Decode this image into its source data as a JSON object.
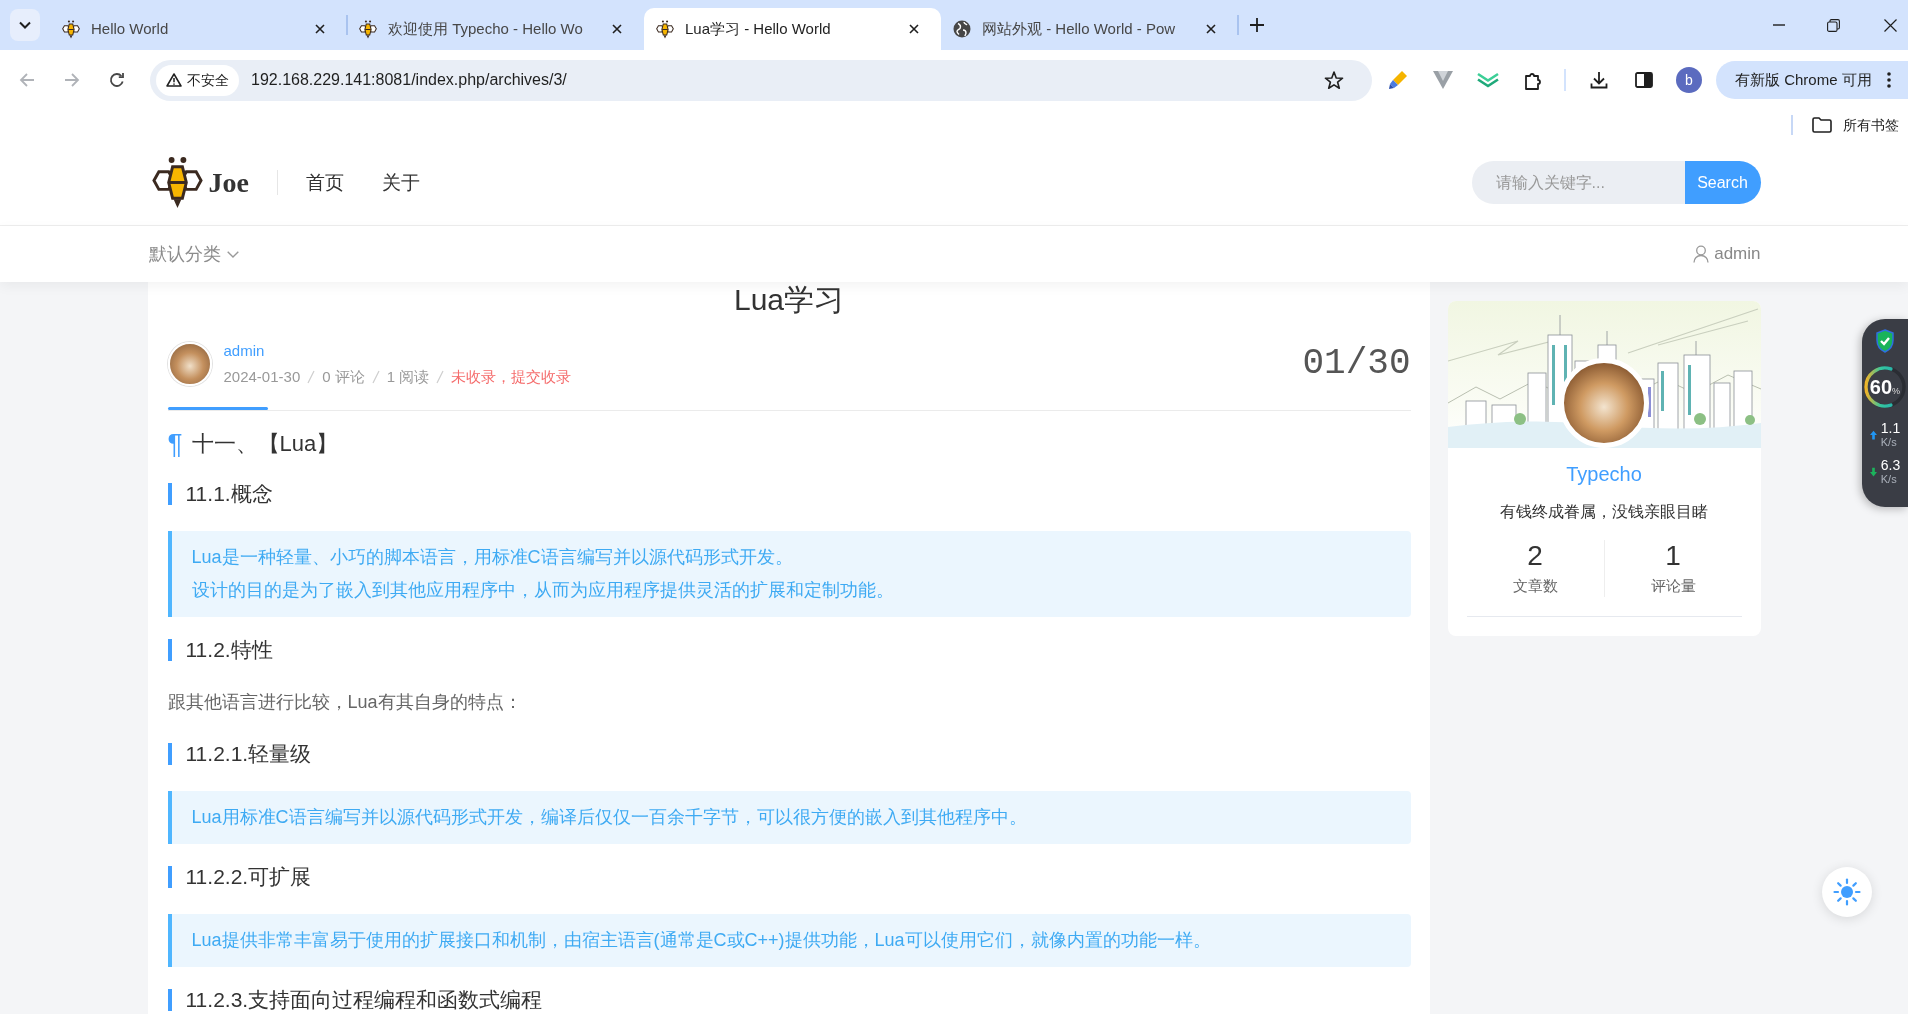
{
  "browser": {
    "tab_strip": {
      "tabs": [
        {
          "title": "Hello World",
          "kind": "bee",
          "selected": false
        },
        {
          "title": "欢迎使用 Typecho - Hello Wo",
          "kind": "bee",
          "selected": false
        },
        {
          "title": "Lua学习 - Hello World",
          "kind": "bee",
          "selected": true
        },
        {
          "title": "网站外观 - Hello World - Pow",
          "kind": "globe",
          "selected": false
        }
      ]
    },
    "toolbar": {
      "back": {
        "disabled": true
      },
      "forward": {
        "disabled": true
      },
      "security_chip": "不安全",
      "url": "192.168.229.141:8081/index.php/archives/3/",
      "profile_initial": "b",
      "update_button": "有新版 Chrome 可用"
    },
    "bookmarks_bar": {
      "folder": "所有书签"
    }
  },
  "site_header": {
    "logo_text": "Joe",
    "nav": [
      {
        "label": "首页"
      },
      {
        "label": "关于"
      }
    ],
    "search": {
      "placeholder": "请输入关键字...",
      "button": "Search"
    }
  },
  "sub_nav": {
    "category": "默认分类",
    "user": "admin"
  },
  "article": {
    "title": "Lua学习",
    "author": "admin",
    "meta": [
      {
        "kind": "plain",
        "text": "2024-01-30"
      },
      {
        "kind": "plain",
        "text": "0 评论"
      },
      {
        "kind": "plain",
        "text": "1 阅读"
      },
      {
        "kind": "alert",
        "text": "未收录，提交收录"
      }
    ],
    "date_badge": "01/30",
    "content": [
      {
        "kind": "h1",
        "anchor": "¶",
        "text": "十一、【Lua】"
      },
      {
        "kind": "h2",
        "text": "11.1.概念"
      },
      {
        "kind": "quote",
        "lines": [
          "Lua是一种轻量、小巧的脚本语言，用标准C语言编写并以源代码形式开发。",
          "设计的目的是为了嵌入到其他应用程序中，从而为应用程序提供灵活的扩展和定制功能。"
        ]
      },
      {
        "kind": "h2",
        "text": "11.2.特性"
      },
      {
        "kind": "p",
        "text": "跟其他语言进行比较，Lua有其自身的特点："
      },
      {
        "kind": "h2",
        "text": "11.2.1.轻量级"
      },
      {
        "kind": "quote",
        "lines": [
          "Lua用标准C语言编写并以源代码形式开发，编译后仅仅一百余千字节，可以很方便的嵌入到其他程序中。"
        ]
      },
      {
        "kind": "h2",
        "text": "11.2.2.可扩展"
      },
      {
        "kind": "quote",
        "lines": [
          "Lua提供非常丰富易于使用的扩展接口和机制，由宿主语言(通常是C或C++)提供功能，Lua可以使用它们，就像内置的功能一样。"
        ]
      },
      {
        "kind": "h2",
        "text": "11.2.3.支持面向过程编程和函数式编程"
      }
    ]
  },
  "sidebar": {
    "author_card": {
      "name": "Typecho",
      "motto": "有钱终成眷属，没钱亲眼目睹",
      "stats": [
        {
          "value": "2",
          "label": "文章数"
        },
        {
          "value": "1",
          "label": "评论量"
        }
      ]
    }
  },
  "net_monitor": {
    "load": "60",
    "load_unit": "%",
    "level": 0.6,
    "upload": {
      "value": "1.1",
      "unit": "K/s"
    },
    "download": {
      "value": "6.3",
      "unit": "K/s"
    }
  }
}
